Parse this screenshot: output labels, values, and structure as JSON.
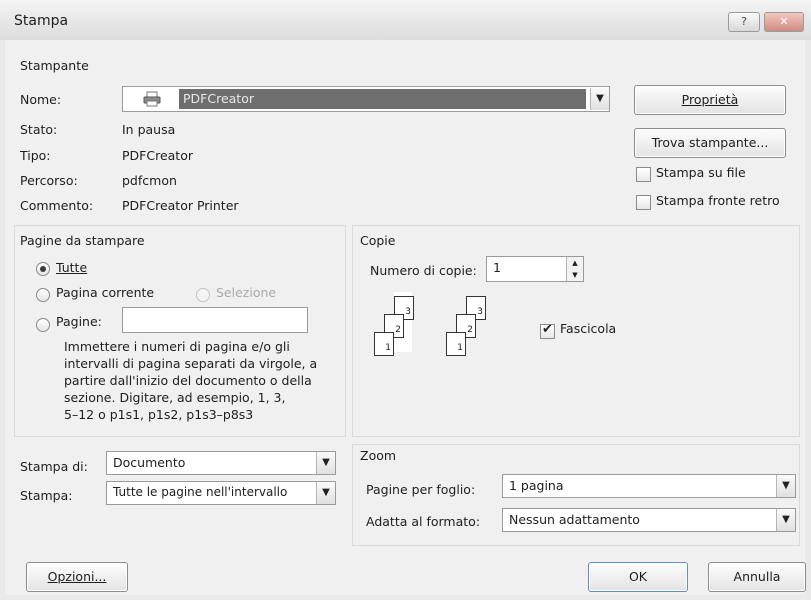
{
  "window": {
    "title": "Stampa",
    "help_label": "?",
    "close_label": "✕"
  },
  "printer": {
    "section_label": "Stampante",
    "name_label": "Nome:",
    "name_value": "PDFCreator",
    "status_label": "Stato:",
    "status_value": "In pausa",
    "type_label": "Tipo:",
    "type_value": "PDFCreator",
    "path_label": "Percorso:",
    "path_value": "pdfcmon",
    "comment_label": "Commento:",
    "comment_value": "PDFCreator Printer",
    "properties_button": "Proprietà",
    "find_printer_button": "Trova stampante...",
    "print_to_file_label": "Stampa su file",
    "duplex_label": "Stampa fronte retro"
  },
  "pages": {
    "section_label": "Pagine da stampare",
    "all_label": "Tutte",
    "current_label": "Pagina corrente",
    "selection_label": "Selezione",
    "pages_label": "Pagine:",
    "pages_value": "",
    "help_text_lines": [
      "Immettere i numeri di pagina e/o gli",
      "intervalli di pagina separati da virgole, a",
      "partire dall'inizio del documento o della",
      "sezione. Digitare, ad esempio, 1, 3,",
      "5–12 o p1s1, p1s2, p1s3–p8s3"
    ]
  },
  "copies": {
    "section_label": "Copie",
    "count_label": "Numero di copie:",
    "count_value": "1",
    "collate_label": "Fascicola",
    "collate_checked": true,
    "sheet_numbers": [
      "3",
      "2",
      "1"
    ]
  },
  "print_what": {
    "label": "Stampa di:",
    "value": "Documento"
  },
  "print_range": {
    "label": "Stampa:",
    "value": "Tutte le pagine nell'intervallo"
  },
  "zoom": {
    "section_label": "Zoom",
    "pages_per_sheet_label": "Pagine per foglio:",
    "pages_per_sheet_value": "1 pagina",
    "scale_label": "Adatta al formato:",
    "scale_value": "Nessun adattamento"
  },
  "footer": {
    "options_button": "Opzioni...",
    "ok_button": "OK",
    "cancel_button": "Annulla"
  },
  "colors": {
    "selected_printer_bg": "#6e6e6e",
    "dialog_bg": "#f0f0f0"
  }
}
